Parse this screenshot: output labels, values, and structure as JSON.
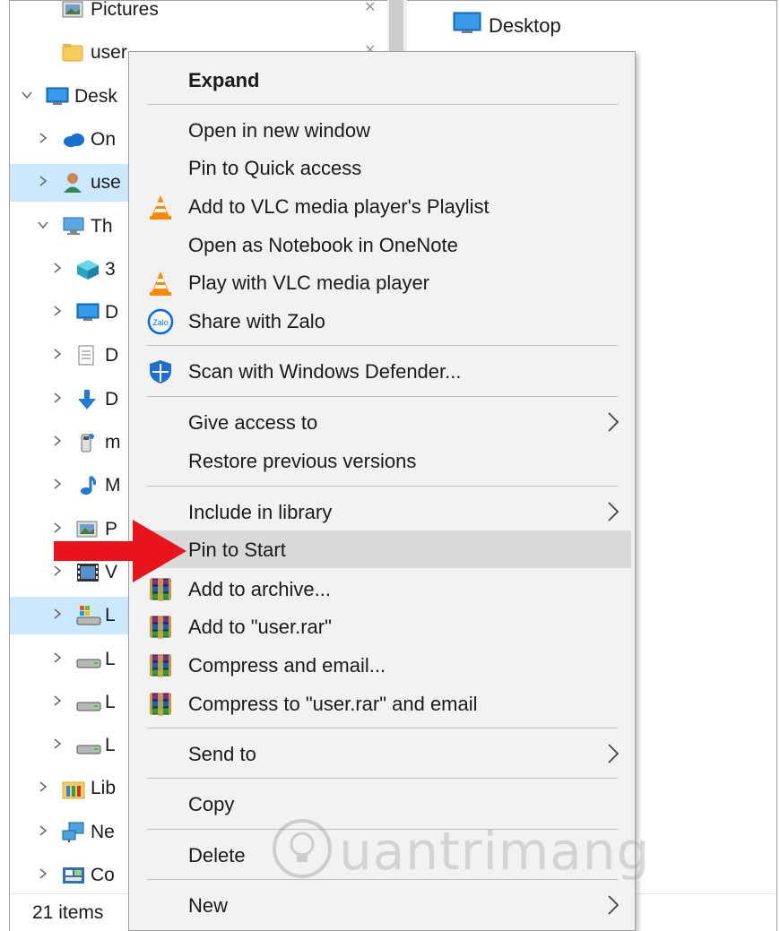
{
  "nav_items": [
    {
      "label": "Pictures",
      "chevron": "",
      "icon": "pictures-icon",
      "pinned": true
    },
    {
      "label": "user",
      "chevron": "",
      "icon": "folder-icon",
      "pinned": true
    },
    {
      "label": "Desk",
      "chevron": "down",
      "icon": "desktop-icon"
    },
    {
      "label": "On",
      "chevron": "right",
      "icon": "onedrive-icon"
    },
    {
      "label": "use",
      "chevron": "right",
      "icon": "user-icon",
      "selected": true
    },
    {
      "label": "Th",
      "chevron": "down",
      "icon": "this-pc-icon"
    },
    {
      "label": "3",
      "chevron": "right",
      "icon": "3d-objects-icon"
    },
    {
      "label": "D",
      "chevron": "right",
      "icon": "desktop-icon"
    },
    {
      "label": "D",
      "chevron": "right",
      "icon": "documents-icon"
    },
    {
      "label": "D",
      "chevron": "right",
      "icon": "downloads-icon"
    },
    {
      "label": "m",
      "chevron": "right",
      "icon": "media-icon"
    },
    {
      "label": "M",
      "chevron": "right",
      "icon": "music-icon"
    },
    {
      "label": "P",
      "chevron": "right",
      "icon": "pictures-icon"
    },
    {
      "label": "V",
      "chevron": "right",
      "icon": "videos-icon"
    },
    {
      "label": "L",
      "chevron": "right",
      "icon": "local-disk-icon",
      "selected": true
    },
    {
      "label": "L",
      "chevron": "right",
      "icon": "drive-icon"
    },
    {
      "label": "L",
      "chevron": "right",
      "icon": "drive-icon"
    },
    {
      "label": "L",
      "chevron": "right",
      "icon": "drive-icon"
    },
    {
      "label": "Lib",
      "chevron": "right",
      "icon": "libraries-icon"
    },
    {
      "label": "Ne",
      "chevron": "right",
      "icon": "network-icon"
    },
    {
      "label": "Co",
      "chevron": "right",
      "icon": "control-panel-icon"
    }
  ],
  "right_pane": {
    "item_label": "Desktop"
  },
  "status": {
    "items_count": "21 items"
  },
  "menu": {
    "items": [
      {
        "label": "Expand",
        "bold": true
      },
      {
        "label": "Open in new window"
      },
      {
        "label": "Pin to Quick access"
      },
      {
        "label": "Add to VLC media player's Playlist",
        "icon": "vlc-icon"
      },
      {
        "label": "Open as Notebook in OneNote"
      },
      {
        "label": "Play with VLC media player",
        "icon": "vlc-icon"
      },
      {
        "label": "Share with Zalo",
        "icon": "zalo-icon",
        "icon_text": "Zalo"
      },
      {
        "label": "Scan with Windows Defender...",
        "icon": "defender-icon"
      },
      {
        "label": "Give access to",
        "submenu": true
      },
      {
        "label": "Restore previous versions"
      },
      {
        "label": "Include in library",
        "submenu": true
      },
      {
        "label": "Pin to Start",
        "highlighted": true
      },
      {
        "label": "Add to archive...",
        "icon": "winrar-icon"
      },
      {
        "label": "Add to \"user.rar\"",
        "icon": "winrar-icon"
      },
      {
        "label": "Compress and email...",
        "icon": "winrar-icon"
      },
      {
        "label": "Compress to \"user.rar\" and email",
        "icon": "winrar-icon"
      },
      {
        "label": "Send to",
        "submenu": true
      },
      {
        "label": "Copy"
      },
      {
        "label": "Delete"
      },
      {
        "label": "New",
        "submenu": true
      }
    ]
  },
  "watermark": {
    "text": "uantrimang"
  },
  "colors": {
    "selection": "#cce8ff",
    "menu_bg": "#f2f2f2",
    "menu_highlight": "#d9d9d9",
    "arrow": "#e8141b"
  }
}
